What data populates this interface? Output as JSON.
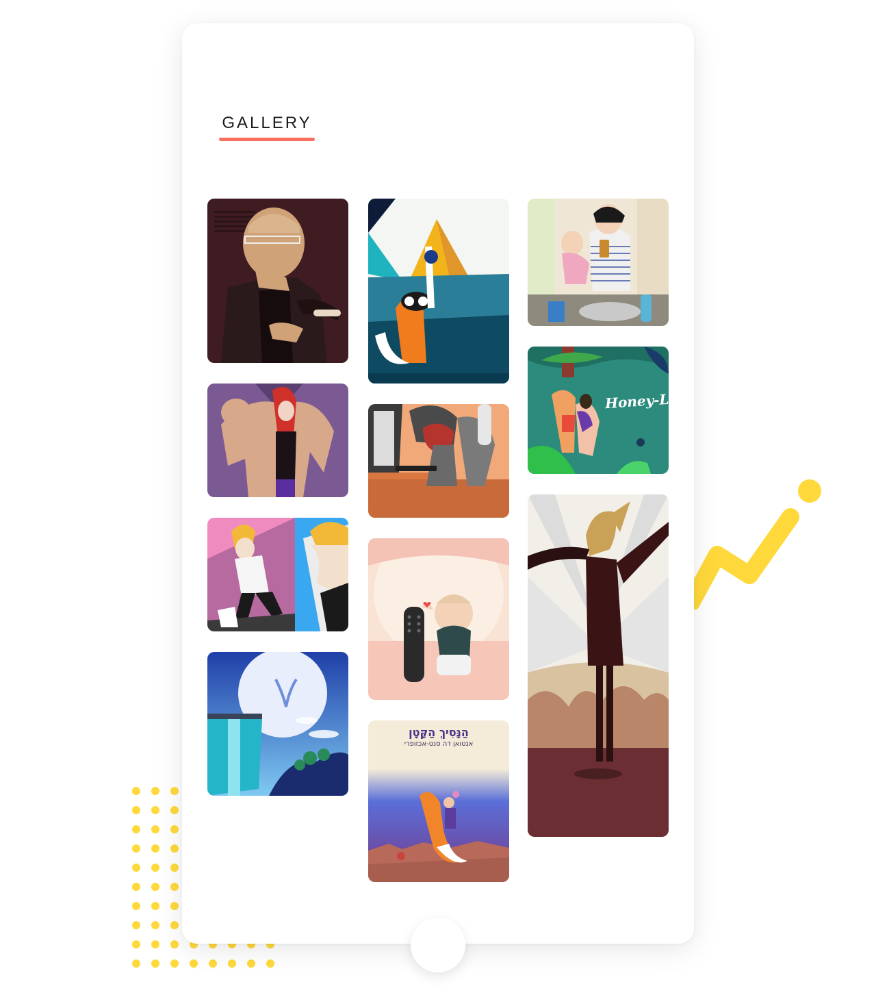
{
  "gallery": {
    "title": "GALLERY",
    "underline_color": "#f76f5f"
  },
  "accent_colors": {
    "dots": "#ffd93b",
    "zigzag": "#ffd93b"
  },
  "tiles": [
    {
      "name": "bald-man-with-glasses-illustration",
      "dominant_color": "#3e1c22"
    },
    {
      "name": "fox-under-pyramid-illustration",
      "dominant_color": "#1e5a6b"
    },
    {
      "name": "mother-and-child-bathroom-illustration",
      "dominant_color": "#efe6d6"
    },
    {
      "name": "muscle-man-and-redhead-illustration",
      "dominant_color": "#7b5a94"
    },
    {
      "name": "gamer-at-computer-illustration",
      "dominant_color": "#f2a97a"
    },
    {
      "name": "honey-couple-jungle-illustration",
      "dominant_color": "#2c8b7c",
      "text": "Honey-L"
    },
    {
      "name": "blond-man-split-panel-illustration",
      "dominant_color": "#f08bbf"
    },
    {
      "name": "baby-with-remote-illustration",
      "dominant_color": "#f7d8c8"
    },
    {
      "name": "rabbit-in-suit-illustration",
      "dominant_color": "#6b2f33"
    },
    {
      "name": "moon-cliff-deer-illustration",
      "dominant_color": "#2f5bbf"
    },
    {
      "name": "little-prince-fox-cover-illustration",
      "dominant_color": "#4b5bc9",
      "title": "הַנָּסִיךְ הַקָּטָן",
      "subtitle": "אנטואן דה סנט-אכזופרי"
    }
  ]
}
